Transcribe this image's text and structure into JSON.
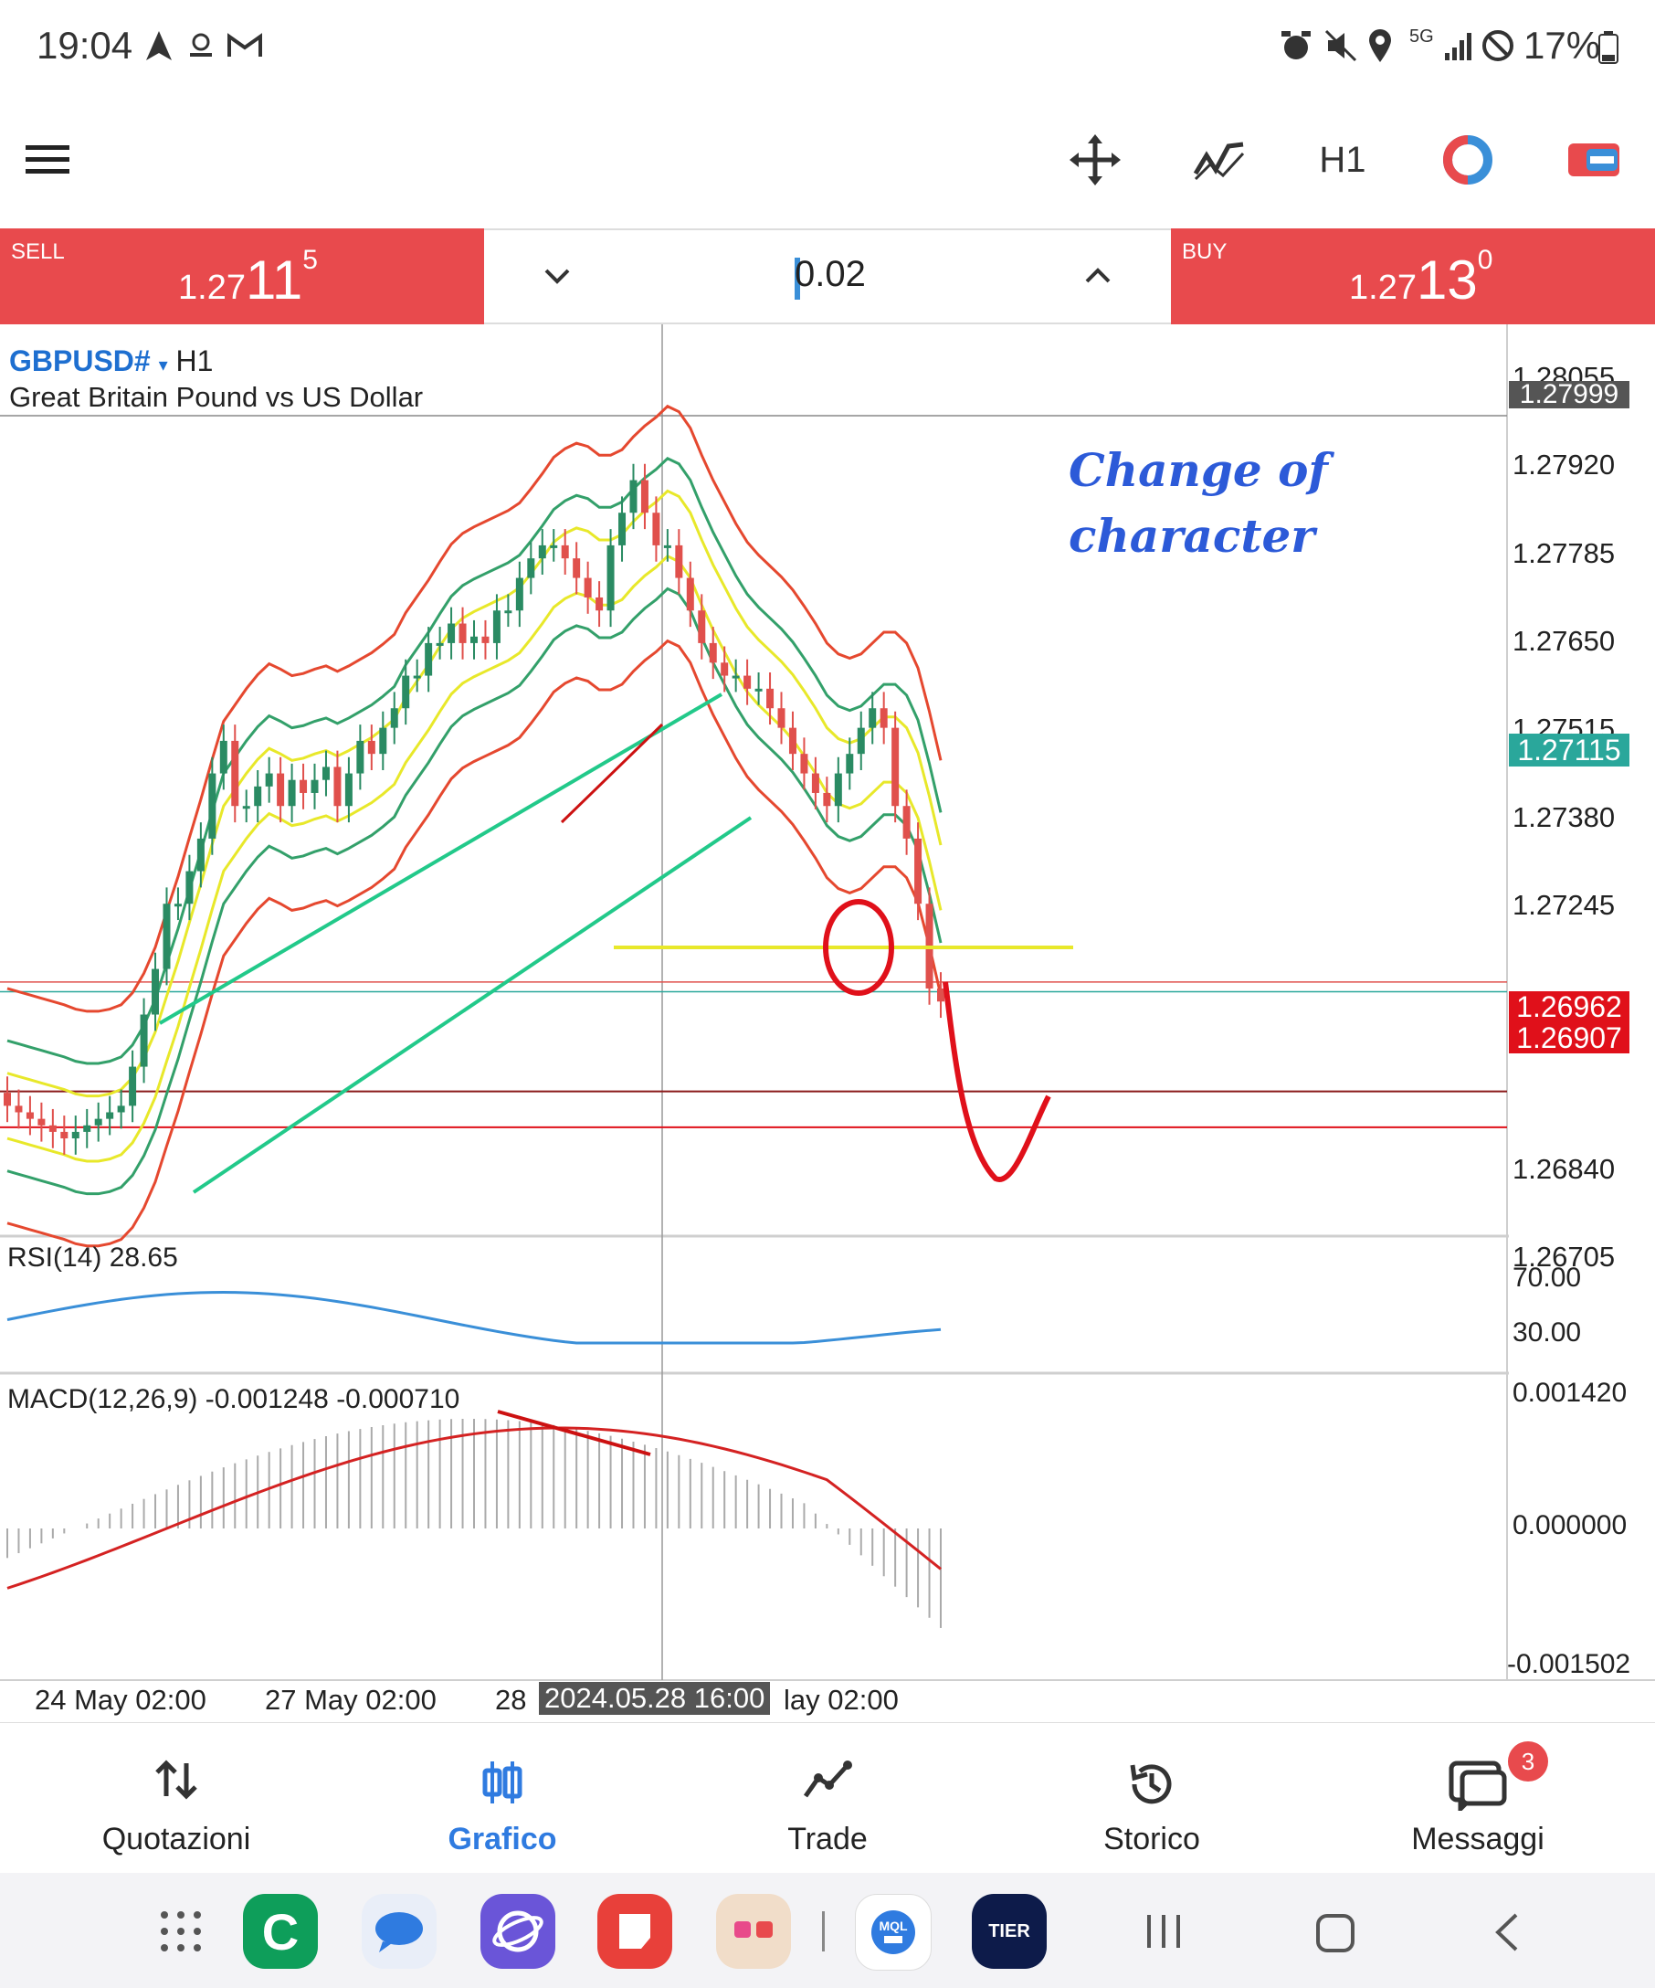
{
  "status_bar": {
    "time": "19:04",
    "battery": "17%",
    "network": "5G"
  },
  "toolbar": {
    "timeframe": "H1",
    "icons": [
      "menu-icon",
      "crosshair-move-icon",
      "indicators-icon",
      "timeframe-button",
      "color-theme-icon",
      "one-click-trading-icon"
    ]
  },
  "trade_bar": {
    "sell_label": "SELL",
    "sell_price_prefix": "1.27",
    "sell_price_big": "11",
    "sell_price_sup": "5",
    "buy_label": "BUY",
    "buy_price_prefix": "1.27",
    "buy_price_big": "13",
    "buy_price_sup": "0",
    "lot_value": "0.02"
  },
  "chart": {
    "symbol": "GBPUSD#",
    "timeframe": "H1",
    "description": "Great Britain Pound vs US Dollar",
    "annotation_line1": "Change of",
    "annotation_line2": "character",
    "price_labels": [
      "1.28055",
      "1.27920",
      "1.27785",
      "1.27650",
      "1.27515",
      "1.27380",
      "1.27245",
      "1.26840",
      "1.26705"
    ],
    "price_boxes": {
      "level_1": "1.27999",
      "bid": "1.27115",
      "level_2": "1.26962",
      "level_3": "1.26907"
    },
    "rsi_label": "RSI(14) 28.65",
    "rsi_levels": [
      "70.00",
      "30.00"
    ],
    "macd_label": "MACD(12,26,9) -0.001248 -0.000710",
    "macd_levels": [
      "0.001420",
      "0.000000",
      "-0.001502"
    ],
    "time_labels": [
      "24 May 02:00",
      "27 May 02:00",
      "28",
      "lay 02:00"
    ],
    "crosshair_time": "2024.05.28 16:00",
    "colors": {
      "bull": "#2a8b63",
      "bear": "#e0504c",
      "bb_red": "#e5482f",
      "bb_green": "#33a06a",
      "bb_yellow": "#e8e82a",
      "channel": "#22c98a",
      "rsi": "#3a8fd8",
      "macd_signal": "#d42222"
    }
  },
  "chart_data": {
    "type": "candlestick",
    "title": "GBPUSD# H1",
    "ylim": [
      1.2657,
      1.2812
    ],
    "close_series_approx": [
      1.2694,
      1.2693,
      1.2692,
      1.2691,
      1.269,
      1.2689,
      1.269,
      1.2691,
      1.2692,
      1.2693,
      1.2694,
      1.27,
      1.2708,
      1.2715,
      1.2725,
      1.2725,
      1.273,
      1.2735,
      1.2745,
      1.275,
      1.274,
      1.274,
      1.2743,
      1.2745,
      1.274,
      1.2744,
      1.2742,
      1.2744,
      1.2746,
      1.274,
      1.2745,
      1.275,
      1.2748,
      1.2752,
      1.2755,
      1.276,
      1.276,
      1.2765,
      1.2765,
      1.2768,
      1.2765,
      1.2766,
      1.2765,
      1.277,
      1.277,
      1.2775,
      1.2778,
      1.278,
      1.278,
      1.2778,
      1.2775,
      1.2772,
      1.277,
      1.278,
      1.2785,
      1.279,
      1.2785,
      1.278,
      1.278,
      1.2775,
      1.277,
      1.2765,
      1.2762,
      1.276,
      1.276,
      1.2758,
      1.2758,
      1.2755,
      1.2752,
      1.2748,
      1.2745,
      1.2742,
      1.274,
      1.2745,
      1.2748,
      1.2752,
      1.2755,
      1.2752,
      1.274,
      1.2735,
      1.2725,
      1.2712,
      1.271
    ],
    "rsi": 28.65,
    "macd": -0.001248,
    "macd_signal": -0.00071
  },
  "bottom_nav": {
    "items": [
      {
        "label": "Quotazioni",
        "icon": "quotes-icon"
      },
      {
        "label": "Grafico",
        "icon": "chart-icon"
      },
      {
        "label": "Trade",
        "icon": "trade-icon"
      },
      {
        "label": "Storico",
        "icon": "history-icon"
      },
      {
        "label": "Messaggi",
        "icon": "messages-icon"
      }
    ],
    "active_color": "#2f7be0",
    "messages_badge": "3"
  },
  "android_nav": {
    "apps": [
      "apps-grid-icon",
      "c-app-icon",
      "messages-app-icon",
      "samsung-internet-icon",
      "notes-app-icon",
      "folder-app-icon",
      "mql5-app-icon",
      "tier-app-icon"
    ],
    "tier_label": "TIER"
  }
}
